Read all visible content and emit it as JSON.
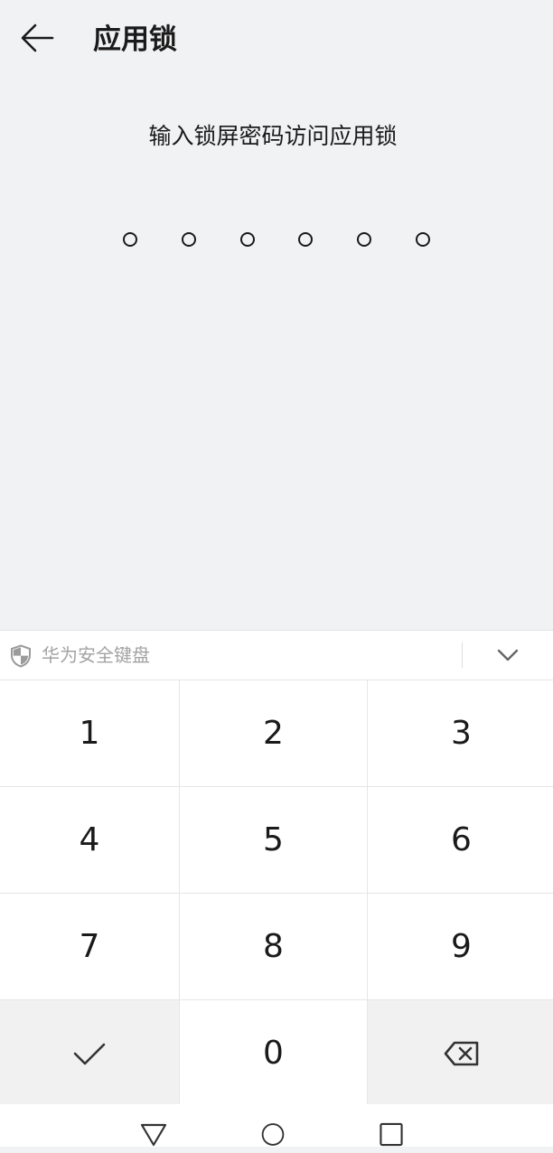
{
  "header": {
    "title": "应用锁",
    "back_icon": "arrow-left-icon"
  },
  "prompt": {
    "text": "输入锁屏密码访问应用锁"
  },
  "pin": {
    "length": 6,
    "entered": 0
  },
  "keyboard": {
    "brand_label": "华为安全键盘",
    "shield_icon": "shield-icon",
    "collapse_icon": "chevron-down-icon",
    "keys": {
      "k1": "1",
      "k2": "2",
      "k3": "3",
      "k4": "4",
      "k5": "5",
      "k6": "6",
      "k7": "7",
      "k8": "8",
      "k9": "9",
      "k0": "0"
    },
    "confirm_icon": "checkmark-icon",
    "delete_icon": "backspace-icon"
  },
  "navbar": {
    "back_icon": "triangle-back-icon",
    "home_icon": "circle-home-icon",
    "recent_icon": "square-recents-icon"
  },
  "colors": {
    "background": "#f1f2f4",
    "text": "#1a1a1a",
    "muted": "#a3a3a3",
    "keyboard": "#ffffff",
    "key_gray": "#f1f1f1"
  }
}
